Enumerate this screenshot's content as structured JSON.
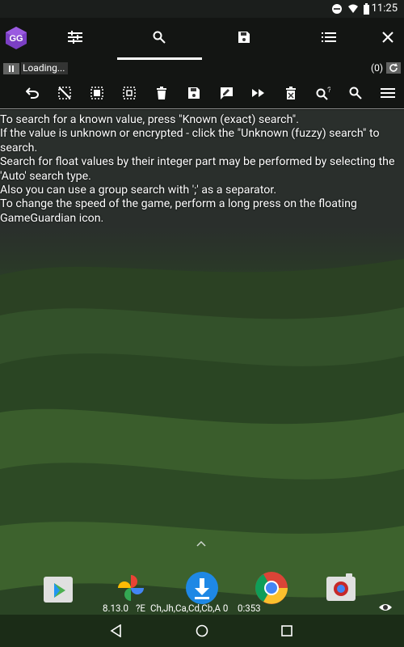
{
  "status": {
    "time": "11:25"
  },
  "toolbar_top": {
    "icons": [
      "logo-icon",
      "tune-icon",
      "search-icon",
      "save-icon",
      "list-icon",
      "close-icon"
    ]
  },
  "progress": {
    "loading_text": "Loading...",
    "count_text": "(0)"
  },
  "toolbar_second": {
    "icons": [
      "undo-icon",
      "clear-selection-icon",
      "select-all-icon",
      "select-range-icon",
      "delete-icon",
      "save-icon",
      "edit-icon",
      "fast-forward-icon",
      "remove-icon",
      "search-question-icon",
      "search-icon",
      "menu-icon"
    ]
  },
  "help": {
    "lines": [
      "To search for a known value, press \"Known (exact) search\".",
      "If the value is unknown or encrypted - click the \"Unknown (fuzzy) search\" to search.",
      "Search for float values by their integer part may be performed by selecting the 'Auto' search type.",
      "Also you can use a group search with ';' as a separator.",
      "To change the speed of the game, perform a long press on the floating GameGuardian icon."
    ]
  },
  "bottom_info": {
    "version": "8.13.0",
    "mode": "?E",
    "regions": "Ch,Jh,Ca,Cd,Cb,A 0",
    "timer": "0:353"
  },
  "colors": {
    "accent": "#7b3fc4",
    "text": "#ffffff"
  }
}
